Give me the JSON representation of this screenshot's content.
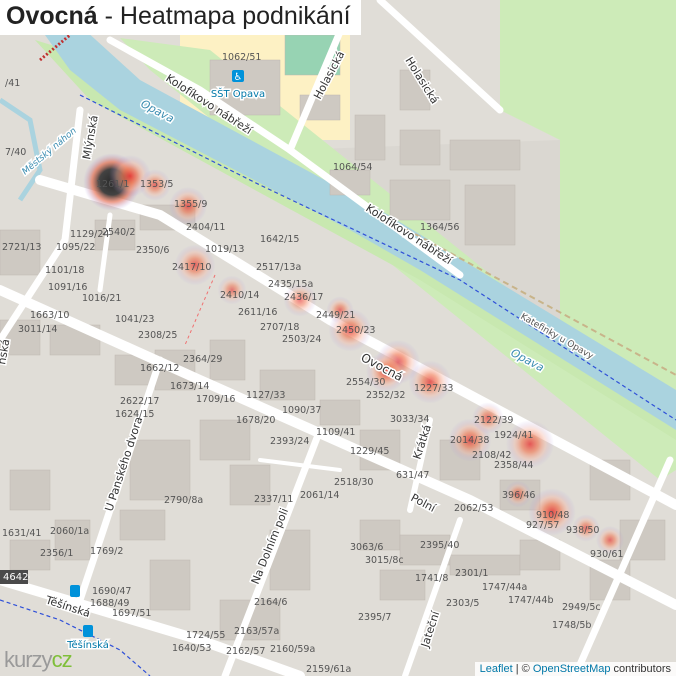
{
  "title": {
    "bold": "Ovocná",
    "rest": " - Heatmapa podnikání"
  },
  "attribution": {
    "leaflet": "Leaflet",
    "sep": " | © ",
    "osm": "OpenStreetMap",
    "contrib": " contributors"
  },
  "logo": {
    "part1": "kurzy",
    "part2": "cz"
  },
  "streets": [
    {
      "label": "Ovocná"
    },
    {
      "label": "Kolofíkovo nábřeží"
    },
    {
      "label": "Kolofíkovo nábřeží"
    },
    {
      "label": "Holasická"
    },
    {
      "label": "Holasická"
    },
    {
      "label": "Mlýnská"
    },
    {
      "label": "U Panského dvora"
    },
    {
      "label": "Na Dolním poli"
    },
    {
      "label": "Polní"
    },
    {
      "label": "Krátká"
    },
    {
      "label": "Jateční"
    },
    {
      "label": "Těšínská"
    },
    {
      "label": "Opava"
    },
    {
      "label": "Opava"
    },
    {
      "label": "Městský náhon"
    },
    {
      "label": "Katefinky u Opavy"
    },
    {
      "label": "nská"
    },
    {
      "label": "4642"
    }
  ],
  "pois": [
    {
      "label": "SŠT Opava",
      "icon": "accessibility-icon"
    },
    {
      "label": "Těšínská",
      "icon": "bus-stop-icon"
    }
  ],
  "house_numbers": [
    {
      "label": "1062/51"
    },
    {
      "label": "1064/54"
    },
    {
      "label": "1364/56"
    },
    {
      "label": "1261/1"
    },
    {
      "label": "1353/5"
    },
    {
      "label": "1355/9"
    },
    {
      "label": "2404/11"
    },
    {
      "label": "1019/13"
    },
    {
      "label": "1642/15"
    },
    {
      "label": "2517/13a"
    },
    {
      "label": "2435/15a"
    },
    {
      "label": "2436/17"
    },
    {
      "label": "2449/21"
    },
    {
      "label": "2450/23"
    },
    {
      "label": "2503/24"
    },
    {
      "label": "2707/18"
    },
    {
      "label": "2611/16"
    },
    {
      "label": "2410/14"
    },
    {
      "label": "2417/10"
    },
    {
      "label": "2350/6"
    },
    {
      "label": "2540/2"
    },
    {
      "label": "1129/24"
    },
    {
      "label": "1095/22"
    },
    {
      "label": "1101/18"
    },
    {
      "label": "1091/16"
    },
    {
      "label": "1016/21"
    },
    {
      "label": "2721/13"
    },
    {
      "label": "7/40"
    },
    {
      "label": "/41"
    },
    {
      "label": "1663/10"
    },
    {
      "label": "3011/14"
    },
    {
      "label": "1041/23"
    },
    {
      "label": "2308/25"
    },
    {
      "label": "2364/29"
    },
    {
      "label": "1662/12"
    },
    {
      "label": "1673/14"
    },
    {
      "label": "2622/17"
    },
    {
      "label": "1624/15"
    },
    {
      "label": "1709/16"
    },
    {
      "label": "1127/33"
    },
    {
      "label": "1678/20"
    },
    {
      "label": "1090/37"
    },
    {
      "label": "2554/30"
    },
    {
      "label": "2352/32"
    },
    {
      "label": "1227/33"
    },
    {
      "label": "3033/34"
    },
    {
      "label": "1109/41"
    },
    {
      "label": "2393/24"
    },
    {
      "label": "1229/45"
    },
    {
      "label": "2122/39"
    },
    {
      "label": "1924/41"
    },
    {
      "label": "2014/38"
    },
    {
      "label": "2108/42"
    },
    {
      "label": "2358/44"
    },
    {
      "label": "631/47"
    },
    {
      "label": "2518/30"
    },
    {
      "label": "396/46"
    },
    {
      "label": "2062/53"
    },
    {
      "label": "910/48"
    },
    {
      "label": "927/57"
    },
    {
      "label": "938/50"
    },
    {
      "label": "930/61"
    },
    {
      "label": "2790/8a"
    },
    {
      "label": "2337/11"
    },
    {
      "label": "2061/14"
    },
    {
      "label": "2060/1a"
    },
    {
      "label": "1631/41"
    },
    {
      "label": "2356/1"
    },
    {
      "label": "1769/2"
    },
    {
      "label": "3063/6"
    },
    {
      "label": "3015/8c"
    },
    {
      "label": "2395/40"
    },
    {
      "label": "2301/1"
    },
    {
      "label": "1741/8"
    },
    {
      "label": "1747/44a"
    },
    {
      "label": "1747/44b"
    },
    {
      "label": "2303/5"
    },
    {
      "label": "2949/5c"
    },
    {
      "label": "1748/5b"
    },
    {
      "label": "1690/47"
    },
    {
      "label": "1688/49"
    },
    {
      "label": "1697/51"
    },
    {
      "label": "2164/6"
    },
    {
      "label": "1724/55"
    },
    {
      "label": "2163/57a"
    },
    {
      "label": "2162/57"
    },
    {
      "label": "2160/59a"
    },
    {
      "label": "2159/61a"
    },
    {
      "label": "1640/53"
    },
    {
      "label": "2395/7"
    }
  ],
  "heat_spots": [
    {
      "intensity": 1.0
    },
    {
      "intensity": 0.7
    },
    {
      "intensity": 0.35
    },
    {
      "intensity": 0.5
    },
    {
      "intensity": 0.45
    },
    {
      "intensity": 0.2
    },
    {
      "intensity": 0.25
    },
    {
      "intensity": 0.3
    },
    {
      "intensity": 0.55
    },
    {
      "intensity": 0.6
    },
    {
      "intensity": 0.55
    },
    {
      "intensity": 0.55
    },
    {
      "intensity": 0.35
    },
    {
      "intensity": 0.6
    },
    {
      "intensity": 0.75
    },
    {
      "intensity": 0.25
    },
    {
      "intensity": 0.6
    },
    {
      "intensity": 0.3
    },
    {
      "intensity": 0.35
    }
  ],
  "colors": {
    "river": "#a9d0dc",
    "park": "#c8f0b4",
    "road": "#ffffff",
    "building": "#cfcac3",
    "school": "#fff3c3"
  }
}
